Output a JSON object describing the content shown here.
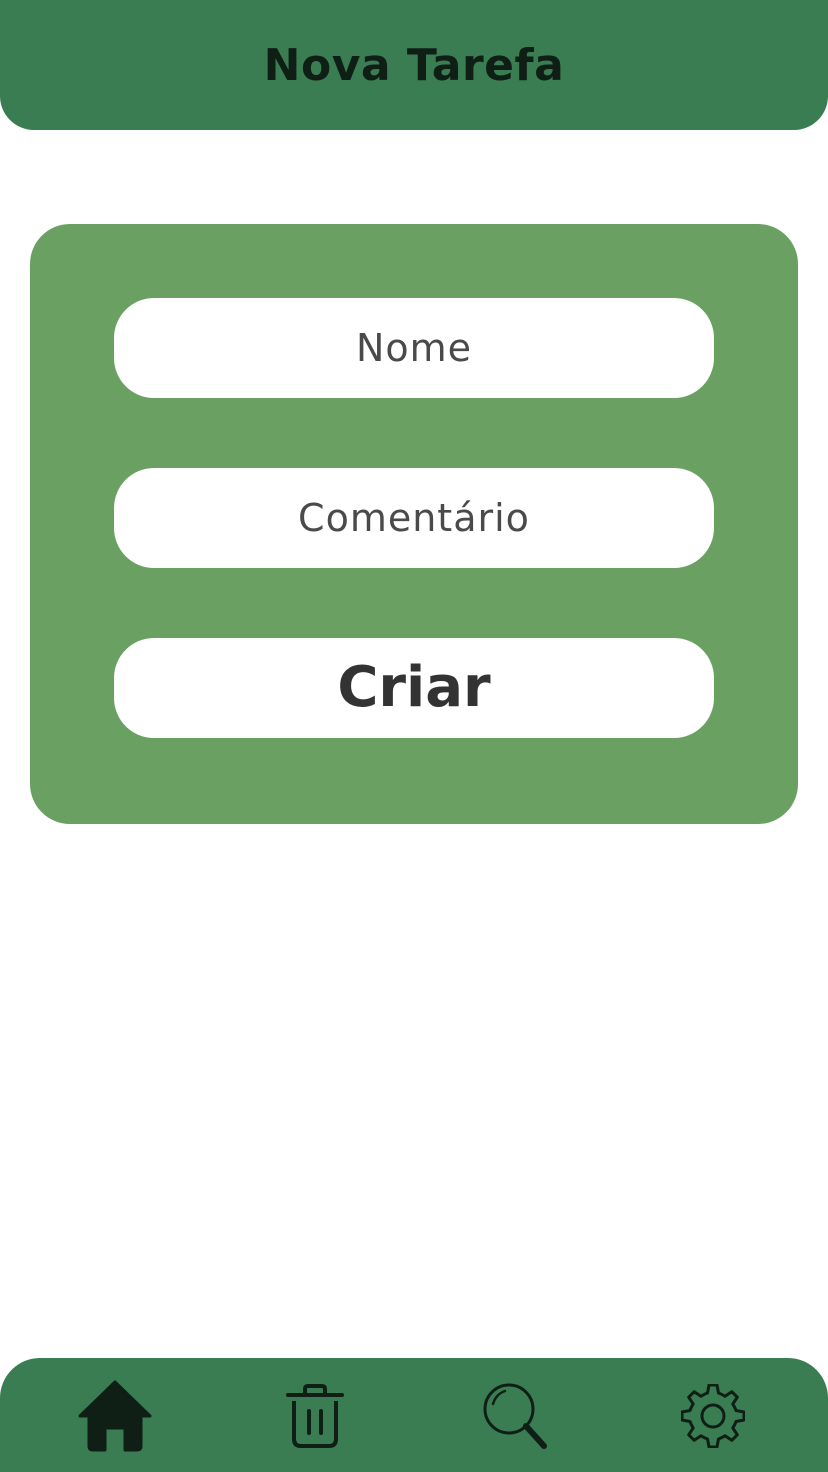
{
  "header": {
    "title": "Nova Tarefa"
  },
  "form": {
    "name_placeholder": "Nome",
    "comment_placeholder": "Comentário",
    "submit_label": "Criar"
  },
  "bottom_nav": {
    "items": [
      {
        "icon": "home-icon",
        "active": true
      },
      {
        "icon": "trash-icon",
        "active": false
      },
      {
        "icon": "search-icon",
        "active": false
      },
      {
        "icon": "gear-icon",
        "active": false
      }
    ]
  },
  "colors": {
    "header_bg": "#3a7d52",
    "card_bg": "#6aa163",
    "nav_bg": "#3a7d52",
    "icon_color": "#0f1f15"
  }
}
